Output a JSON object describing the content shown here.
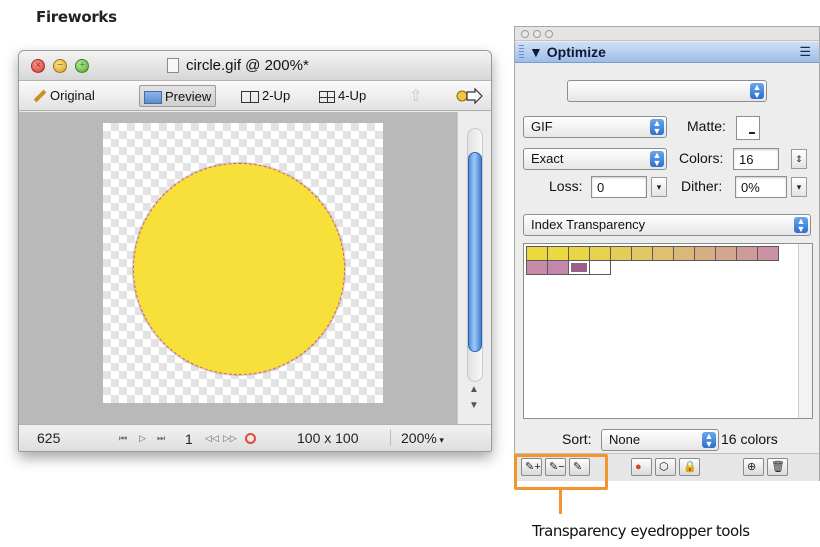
{
  "app_label": "Fireworks",
  "document": {
    "title": "circle.gif @ 200%*",
    "tabs": [
      {
        "label": "Original"
      },
      {
        "label": "Preview"
      },
      {
        "label": "2-Up"
      },
      {
        "label": "4-Up"
      }
    ],
    "active_tab": "Preview",
    "status": {
      "frame_delay": "625",
      "frame_number": "1",
      "image_size": "100 x 100",
      "zoom": "200%"
    },
    "image": {
      "fill_color": "#f8e03a",
      "matte_outline_color": "#b66a88"
    }
  },
  "optimize": {
    "panel_title": "Optimize",
    "preset_value": "",
    "format": "GIF",
    "matte_label": "Matte:",
    "palette": "Exact",
    "colors_label": "Colors:",
    "colors_value": "16",
    "loss_label": "Loss:",
    "loss_value": "0",
    "dither_label": "Dither:",
    "dither_value": "0%",
    "transparency": "Index Transparency",
    "swatches": [
      "#ecd93f",
      "#ebd842",
      "#e9d546",
      "#e7d24d",
      "#e4cc58",
      "#e2c765",
      "#dfc070",
      "#dbb77a",
      "#d7ae84",
      "#d3a68f",
      "#cf9b99",
      "#cb92a2",
      "#c88aa9",
      "#c485ae",
      "#9a5f86",
      "#ffffff"
    ],
    "sort_label": "Sort:",
    "sort_value": "None",
    "colors_count": "16 colors"
  },
  "callout": {
    "label": "Transparency eyedropper tools",
    "color": "#f29531"
  }
}
